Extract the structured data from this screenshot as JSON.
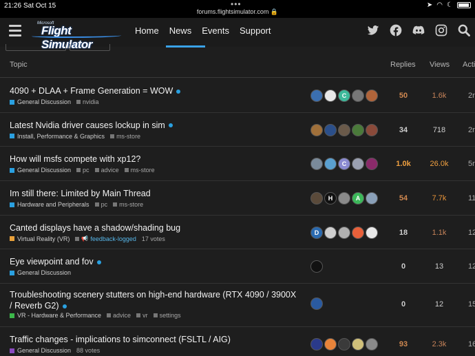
{
  "status_bar": {
    "time": "21:26",
    "date": "Sat Oct 15",
    "url": "forums.flightsimulator.com"
  },
  "header": {
    "logo_small": "Microsoft",
    "logo_text": "Flight Simulator",
    "nav": [
      "Home",
      "News",
      "Events",
      "Support"
    ],
    "active_nav": "News",
    "social_icons": [
      "twitter-icon",
      "facebook-icon",
      "discord-icon",
      "instagram-icon",
      "search-icon"
    ]
  },
  "table": {
    "headers": {
      "topic": "Topic",
      "replies": "Replies",
      "views": "Views",
      "activity": "Acti"
    }
  },
  "colors": {
    "accent": "#2aa0e0",
    "hot": "#e8943a",
    "warm": "#c8845a"
  },
  "topics": [
    {
      "title": "4090 + DLAA + Frame Generation = WOW",
      "unread": true,
      "category": "General Discussion",
      "cat_color": "#2aa0e0",
      "tags": [
        "nvidia"
      ],
      "votes": "",
      "replies": "50",
      "views": "1.6k",
      "activity": "2r",
      "replies_color": "#d08850",
      "views_color": "#c8845a",
      "avatars": [
        {
          "bg": "#3b6fb0",
          "l": ""
        },
        {
          "bg": "#e8e8e8",
          "l": ""
        },
        {
          "bg": "#3cb89a",
          "l": "C"
        },
        {
          "bg": "#777",
          "l": ""
        },
        {
          "bg": "#b0643a",
          "l": ""
        }
      ]
    },
    {
      "title": "Latest Nvidia driver causes lockup in sim",
      "unread": true,
      "category": "Install, Performance & Graphics",
      "cat_color": "#2aa0e0",
      "tags": [
        "ms-store"
      ],
      "votes": "",
      "replies": "34",
      "views": "718",
      "activity": "2r",
      "replies_color": "#cfcfcf",
      "views_color": "#cfcfcf",
      "avatars": [
        {
          "bg": "#a0703a",
          "l": ""
        },
        {
          "bg": "#2b4f8a",
          "l": ""
        },
        {
          "bg": "#6a5a4a",
          "l": ""
        },
        {
          "bg": "#4a7a3a",
          "l": ""
        },
        {
          "bg": "#8a4a3a",
          "l": ""
        }
      ]
    },
    {
      "title": "How will msfs compete with xp12?",
      "unread": false,
      "category": "General Discussion",
      "cat_color": "#2aa0e0",
      "tags": [
        "pc",
        "advice",
        "ms-store"
      ],
      "votes": "",
      "replies": "1.0k",
      "views": "26.0k",
      "activity": "5n",
      "replies_color": "#f0a040",
      "views_color": "#f0a040",
      "avatars": [
        {
          "bg": "#7a8a9a",
          "l": ""
        },
        {
          "bg": "#5aa0d0",
          "l": ""
        },
        {
          "bg": "#8a8ad0",
          "l": "C"
        },
        {
          "bg": "#9aa0b0",
          "l": ""
        },
        {
          "bg": "#8a2a6a",
          "l": ""
        }
      ]
    },
    {
      "title": "Im still there: Limited by Main Thread",
      "unread": false,
      "category": "Hardware and Peripherals",
      "cat_color": "#2aa0e0",
      "tags": [
        "pc",
        "ms-store"
      ],
      "votes": "",
      "replies": "54",
      "views": "7.7k",
      "activity": "11",
      "replies_color": "#d08850",
      "views_color": "#e8943a",
      "avatars": [
        {
          "bg": "#5a4a3a",
          "l": ""
        },
        {
          "bg": "#111",
          "l": "H"
        },
        {
          "bg": "#8a8a8a",
          "l": ""
        },
        {
          "bg": "#3cb85a",
          "l": "A"
        },
        {
          "bg": "#8aa0b8",
          "l": ""
        }
      ]
    },
    {
      "title": "Canted displays have a shadow/shading bug",
      "unread": false,
      "category": "Virtual Reality (VR)",
      "cat_color": "#e8a03a",
      "tags": [],
      "logged_tag": "feedback-logged",
      "votes": "17 votes",
      "replies": "18",
      "views": "1.1k",
      "activity": "12",
      "replies_color": "#cfcfcf",
      "views_color": "#c8845a",
      "avatars": [
        {
          "bg": "#2a6ab0",
          "l": "D"
        },
        {
          "bg": "#cfcfcf",
          "l": ""
        },
        {
          "bg": "#b0b0b0",
          "l": ""
        },
        {
          "bg": "#e8603a",
          "l": ""
        },
        {
          "bg": "#e8e8e8",
          "l": ""
        }
      ]
    },
    {
      "title": "Eye viewpoint and fov",
      "unread": true,
      "category": "General Discussion",
      "cat_color": "#2aa0e0",
      "tags": [],
      "votes": "",
      "replies": "0",
      "views": "13",
      "activity": "12",
      "replies_color": "#cfcfcf",
      "views_color": "#cfcfcf",
      "avatars": [
        {
          "bg": "#111",
          "l": ""
        }
      ]
    },
    {
      "title": "Troubleshooting scenery stutters on high-end hardware (RTX 4090 / 3900X / Reverb G2)",
      "unread": true,
      "two_line": true,
      "category": "VR - Hardware & Performance",
      "cat_color": "#3cb84a",
      "tags": [
        "advice",
        "vr",
        "settings"
      ],
      "votes": "",
      "replies": "0",
      "views": "12",
      "activity": "15",
      "replies_color": "#cfcfcf",
      "views_color": "#cfcfcf",
      "avatars": [
        {
          "bg": "#2a5aa0",
          "l": ""
        }
      ]
    },
    {
      "title": "Traffic changes - implications to simconnect (FSLTL / AIG)",
      "unread": false,
      "category": "General Discussion",
      "cat_color": "#8a4ac0",
      "tags": [],
      "votes": "88 votes",
      "replies": "93",
      "views": "2.3k",
      "activity": "16",
      "replies_color": "#d08850",
      "views_color": "#c8845a",
      "avatars": [
        {
          "bg": "#2a3a8a",
          "l": ""
        },
        {
          "bg": "#e8843a",
          "l": ""
        },
        {
          "bg": "#3a3a3a",
          "l": ""
        },
        {
          "bg": "#d0c07a",
          "l": ""
        },
        {
          "bg": "#8a8a8a",
          "l": ""
        }
      ]
    }
  ]
}
